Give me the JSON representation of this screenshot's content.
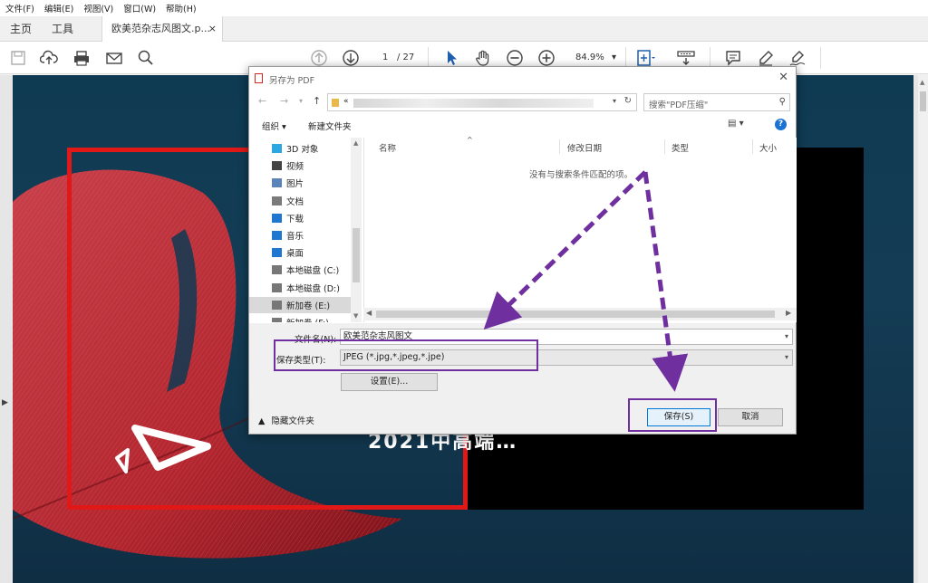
{
  "menu": [
    "文件(F)",
    "编辑(E)",
    "视图(V)",
    "窗口(W)",
    "帮助(H)"
  ],
  "tabs": {
    "home": "主页",
    "tools": "工具",
    "doc": "欧美范杂志风图文.p...",
    "close": "×"
  },
  "toolbar": {
    "page_current": "1",
    "page_total": "/ 27",
    "zoom": "84.9%",
    "zoom_arrow": "▾"
  },
  "page_content": {
    "visible_text": "2021中高端…"
  },
  "dialog": {
    "title": "另存为 PDF",
    "close": "✕",
    "nav_back": "←",
    "nav_forward": "→",
    "nav_recent": "▾",
    "nav_up": "↑",
    "address_prefix": "«",
    "search_placeholder": "搜索\"PDF压缩\"",
    "organize": "组织 ▾",
    "new_folder": "新建文件夹",
    "view_icon": "▤ ▾",
    "help": "?",
    "tree": [
      {
        "label": "3D 对象",
        "icon": "cube-icon",
        "color": "#2aa7e1"
      },
      {
        "label": "视频",
        "icon": "video-icon",
        "color": "#444444"
      },
      {
        "label": "图片",
        "icon": "picture-icon",
        "color": "#5a84b8"
      },
      {
        "label": "文档",
        "icon": "document-icon",
        "color": "#7a7a7a"
      },
      {
        "label": "下载",
        "icon": "download-icon",
        "color": "#1f77d0"
      },
      {
        "label": "音乐",
        "icon": "music-icon",
        "color": "#1f77d0"
      },
      {
        "label": "桌面",
        "icon": "desktop-icon",
        "color": "#1f77d0"
      },
      {
        "label": "本地磁盘 (C:)",
        "icon": "drive-icon",
        "color": "#777777"
      },
      {
        "label": "本地磁盘 (D:)",
        "icon": "drive-icon",
        "color": "#777777"
      },
      {
        "label": "新加卷 (E:)",
        "icon": "drive-icon",
        "color": "#777777"
      },
      {
        "label": "新加卷 (F:)",
        "icon": "drive-icon",
        "color": "#777777"
      }
    ],
    "columns": {
      "name": "名称",
      "date": "修改日期",
      "type": "类型",
      "size": "大小"
    },
    "empty_message": "没有与搜索条件匹配的项。",
    "filename_label": "文件名(N):",
    "filename_value": "欧美范杂志风图文",
    "filetype_label": "保存类型(T):",
    "filetype_value": "JPEG (*.jpg,*.jpeg,*.jpe)",
    "settings_button": "设置(E)...",
    "hide_folders": "隐藏文件夹",
    "save_button": "保存(S)",
    "cancel_button": "取消"
  },
  "colors": {
    "annotation": "#6f2f9f",
    "page_frame": "#e01818"
  }
}
